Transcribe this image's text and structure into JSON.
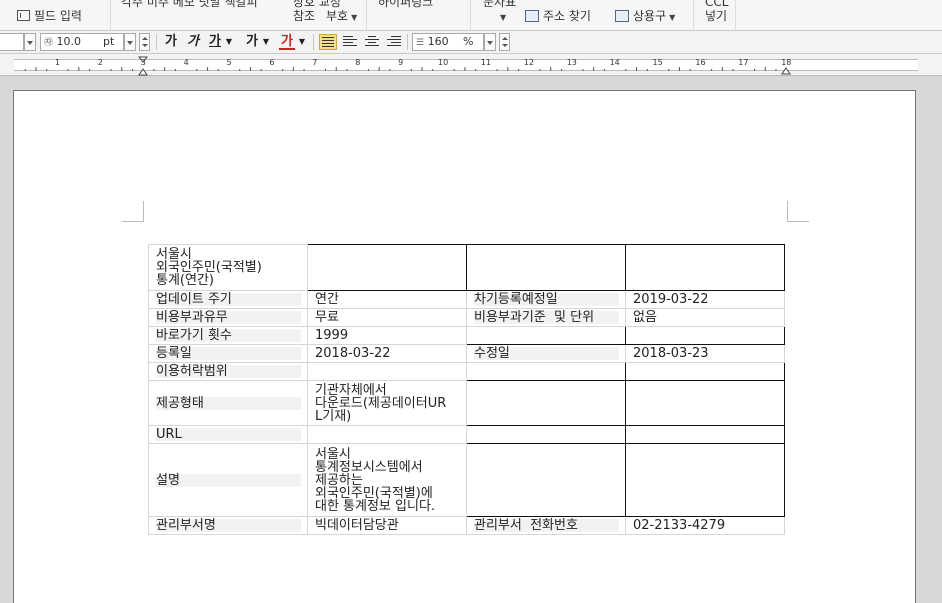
{
  "ribbon": {
    "field_input": "필드 입력",
    "cut_labels": [
      "각주 미주 메모 덧말 책갈피",
      "상호 교정"
    ],
    "cross_ref": "참조",
    "correction_mark": "부호",
    "hyperlink": "하이퍼링크",
    "char_table": "문자표",
    "address_search": "주소 찾기",
    "phrases": "상용구",
    "ccl_top": "CCL",
    "ccl_insert": "넣기"
  },
  "format_bar": {
    "font_size_value": "10.0",
    "font_size_unit": "pt",
    "line_spacing_value": "160",
    "line_spacing_unit": "%",
    "bold": "가",
    "italic": "가",
    "underline": "가",
    "strike": "가",
    "font_color": "가",
    "highlight": "가"
  },
  "ruler": {
    "numbers": [
      "1",
      "2",
      "3",
      "4",
      "5",
      "6",
      "7",
      "8",
      "9",
      "10",
      "11",
      "12",
      "13",
      "14",
      "15",
      "16",
      "17",
      "18"
    ]
  },
  "table": {
    "rows": [
      {
        "c1": "서울시\n외국인주민(국적별)\n통계(연간)",
        "c2": "",
        "c3": "",
        "c4": ""
      },
      {
        "c1": "업데이트 주기",
        "c2": "연간",
        "c3": "차기등록예정일",
        "c4": "2019-03-22"
      },
      {
        "c1": "비용부과유무",
        "c2": "무료",
        "c3": "비용부과기준  및 단위",
        "c4": "없음"
      },
      {
        "c1": "바로가기 횟수",
        "c2": "1999",
        "c3": "",
        "c4": ""
      },
      {
        "c1": "등록일",
        "c2": "2018-03-22",
        "c3": "수정일",
        "c4": "2018-03-23"
      },
      {
        "c1": "이용허락범위",
        "c2": "",
        "c3": "",
        "c4": ""
      },
      {
        "c1": "제공형태",
        "c2": "기관자체에서\n다운로드(제공데이터UR\nL기재)",
        "c3": "",
        "c4": ""
      },
      {
        "c1": "URL",
        "c2": "",
        "c3": "",
        "c4": ""
      },
      {
        "c1": "설명",
        "c2": "서울시\n통계정보시스템에서\n제공하는\n외국인주민(국적별)에\n대한 통계정보 입니다.",
        "c3": "",
        "c4": ""
      },
      {
        "c1": "관리부서명",
        "c2": "빅데이터담당관",
        "c3": "관리부서  전화번호",
        "c4": "02-2133-4279"
      }
    ]
  },
  "colors": {
    "font_color_underline": "#d02020",
    "highlight_active": "#f5dc8c"
  }
}
